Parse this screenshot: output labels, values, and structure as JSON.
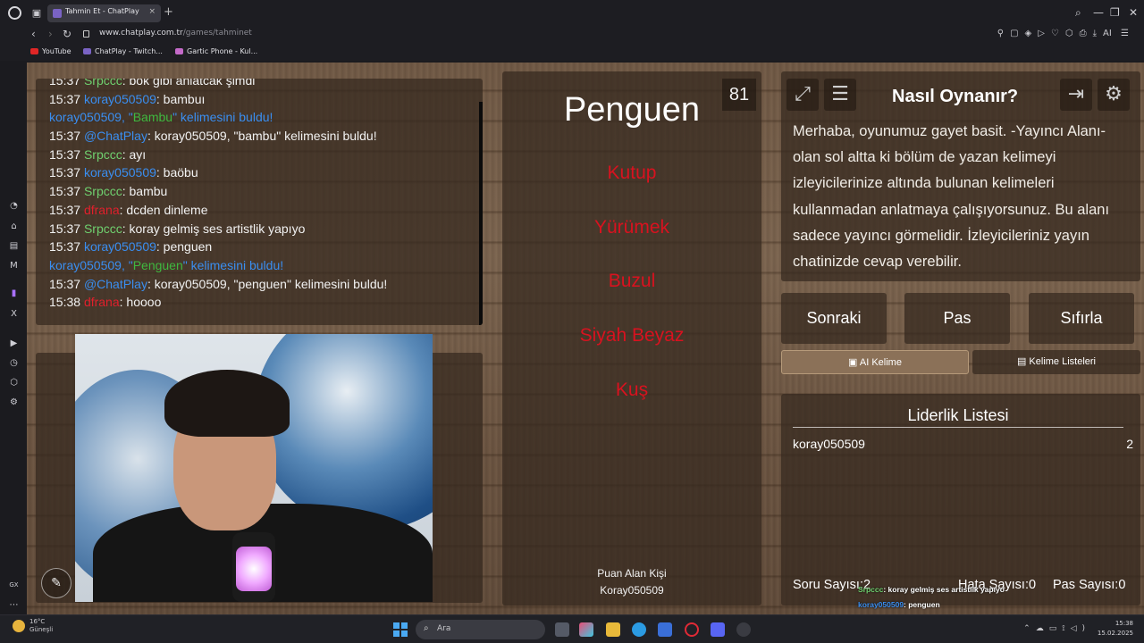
{
  "browser": {
    "tab_title": "Tahmin Et - ChatPlay",
    "url_domain": "www.chatplay.com.tr",
    "url_path": "/games/tahminet",
    "bookmarks": [
      "YouTube",
      "ChatPlay - Twitch...",
      "Gartic Phone - Kul..."
    ],
    "toolbar_ai_label": "AI"
  },
  "chat": {
    "messages": [
      {
        "time": "15:37",
        "user": "Srpccc",
        "user_color": "#6fd06f",
        "text": "bok gibi anlatcak şimdi"
      },
      {
        "time": "15:37",
        "user": "koray050509",
        "user_color": "#3a8ef0",
        "text": "bambuı"
      },
      {
        "notice": "koray050509, \"Bambu\" kelimesini buldu!",
        "word": "Bambu"
      },
      {
        "time": "15:37",
        "user": "@ChatPlay",
        "user_color": "#3a8ef0",
        "text": "koray050509, \"bambu\" kelimesini buldu!"
      },
      {
        "time": "15:37",
        "user": "Srpccc",
        "user_color": "#6fd06f",
        "text": "ayı"
      },
      {
        "time": "15:37",
        "user": "koray050509",
        "user_color": "#3a8ef0",
        "text": "baöbu"
      },
      {
        "time": "15:37",
        "user": "Srpccc",
        "user_color": "#6fd06f",
        "text": "bambu"
      },
      {
        "time": "15:37",
        "user": "dfrana",
        "user_color": "#e0202c",
        "text": "dcden dinleme"
      },
      {
        "time": "15:37",
        "user": "Srpccc",
        "user_color": "#6fd06f",
        "text": "koray gelmiş ses artistlik yapıyo"
      },
      {
        "time": "15:37",
        "user": "koray050509",
        "user_color": "#3a8ef0",
        "text": "penguen"
      },
      {
        "notice": "koray050509, \"Penguen\" kelimesini buldu!",
        "word": "Penguen"
      },
      {
        "time": "15:37",
        "user": "@ChatPlay",
        "user_color": "#3a8ef0",
        "text": "koray050509, \"penguen\" kelimesini buldu!"
      },
      {
        "time": "15:38",
        "user": "dfrana",
        "user_color": "#e0202c",
        "text": "hoooo"
      }
    ]
  },
  "word_panel": {
    "timer": "81",
    "main_word": "Penguen",
    "forbidden": [
      "Kutup",
      "Yürümek",
      "Buzul",
      "Siyah Beyaz",
      "Kuş"
    ],
    "scorer_title": "Puan Alan Kişi",
    "scorer_name": "Koray050509"
  },
  "howto": {
    "title": "Nasıl Oynanır?",
    "text": "Merhaba, oyunumuz gayet basit. -Yayıncı Alanı- olan sol altta ki bölüm de yazan kelimeyi izleyicilerinize altında bulunan kelimeleri kullanmadan anlatmaya çalışıyorsunuz. Bu alanı sadece yayıncı görmelidir. İzleyicileriniz yayın chatinizde cevap verebilir."
  },
  "controls": {
    "next": "Sonraki",
    "pass": "Pas",
    "reset": "Sıfırla",
    "ai_word": "AI Kelime",
    "word_lists": "Kelime Listeleri"
  },
  "leaderboard": {
    "title": "Liderlik Listesi",
    "entries": [
      {
        "name": "koray050509",
        "score": "2"
      }
    ],
    "stats": {
      "questions_label": "Soru Sayısı:",
      "questions": "2",
      "errors_label": "Hata Sayısı:",
      "errors": "0",
      "passes_label": "Pas Sayısı:",
      "passes": "0"
    }
  },
  "overlay": [
    {
      "user": "Srpccc",
      "user_color": "#6fd06f",
      "text": ": koray gelmiş ses artistlik yapıyo"
    },
    {
      "user": "koray050509",
      "user_color": "#3a8ef0",
      "text": ": penguen"
    },
    {
      "user": "@ChatPlay",
      "user_color": "#3a8ef0",
      "text": ": koray050509, \"penguen\" kelimesini buldu!"
    },
    {
      "user": "dfrana",
      "user_color": "#e0202c",
      "text": ": hoooo"
    }
  ],
  "taskbar": {
    "weather_temp": "16°C",
    "weather_desc": "Güneşli",
    "search_placeholder": "Ara",
    "time": "15:38",
    "date": "15.02.2025"
  }
}
